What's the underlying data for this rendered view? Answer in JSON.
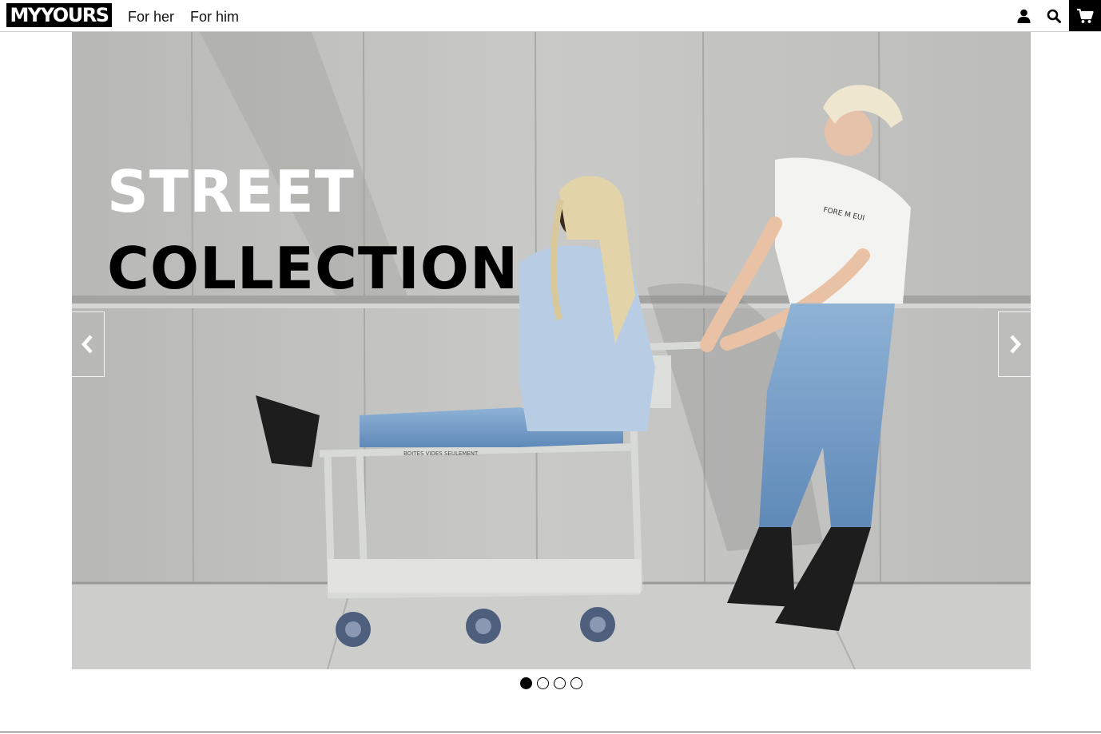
{
  "brand": {
    "logo_text": "MYYOURS"
  },
  "nav": {
    "items": [
      {
        "label": "For her"
      },
      {
        "label": "For him"
      }
    ]
  },
  "header_icons": [
    "user-icon",
    "search-icon",
    "cart-icon"
  ],
  "hero": {
    "title_line_1": "STREET",
    "title_line_2": "COLLECTION",
    "cart_sign": "BOITES VIDES SEULEMENT",
    "shirt_print": "FORE M EUI"
  },
  "slider": {
    "slide_count": 4,
    "active_index": 0
  },
  "colors": {
    "accent": "#000000",
    "background": "#ffffff"
  }
}
